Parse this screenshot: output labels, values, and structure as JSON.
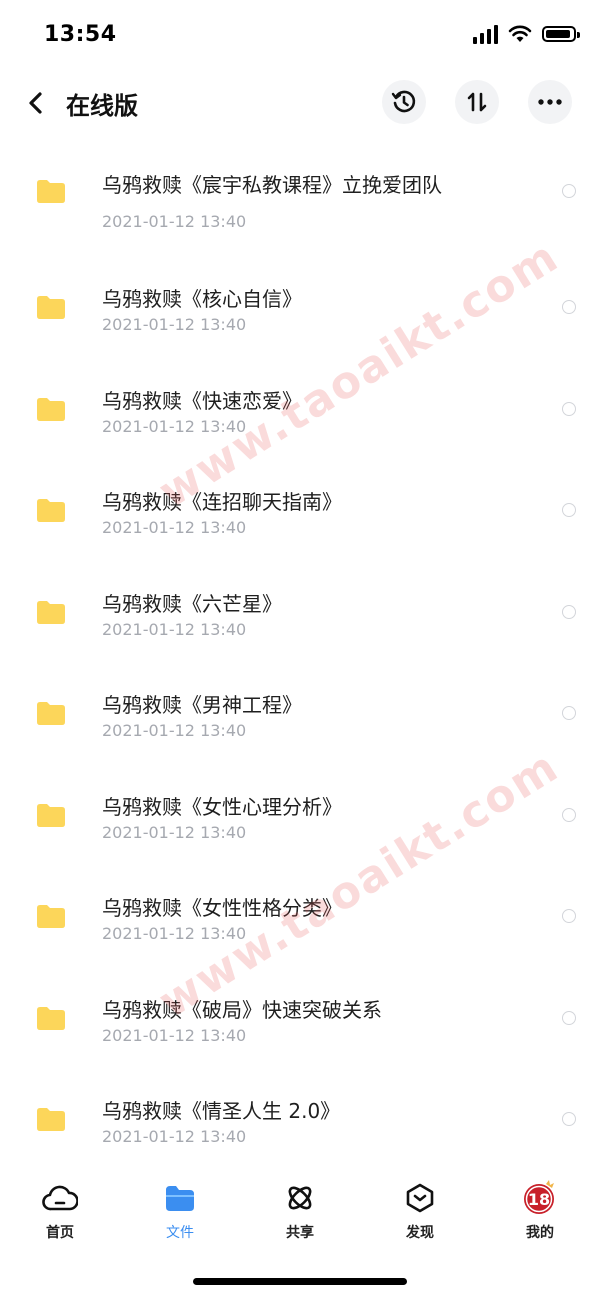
{
  "status_bar": {
    "time": "13:54"
  },
  "header": {
    "title": "在线版",
    "back_icon": "chevron-left-icon",
    "actions": [
      "history-icon",
      "sort-icon",
      "more-icon"
    ]
  },
  "files": [
    {
      "name": "乌鸦救赎《宸宇私教课程》立挽爱团队",
      "date": "2021-01-12 13:40"
    },
    {
      "name": "乌鸦救赎《核心自信》",
      "date": "2021-01-12 13:40"
    },
    {
      "name": "乌鸦救赎《快速恋爱》",
      "date": "2021-01-12 13:40"
    },
    {
      "name": "乌鸦救赎《连招聊天指南》",
      "date": "2021-01-12 13:40"
    },
    {
      "name": "乌鸦救赎《六芒星》",
      "date": "2021-01-12 13:40"
    },
    {
      "name": "乌鸦救赎《男神工程》",
      "date": "2021-01-12 13:40"
    },
    {
      "name": "乌鸦救赎《女性心理分析》",
      "date": "2021-01-12 13:40"
    },
    {
      "name": "乌鸦救赎《女性性格分类》",
      "date": "2021-01-12 13:40"
    },
    {
      "name": "乌鸦救赎《破局》快速突破关系",
      "date": "2021-01-12 13:40"
    },
    {
      "name": "乌鸦救赎《情圣人生 2.0》",
      "date": "2021-01-12 13:40"
    }
  ],
  "watermark": {
    "text": "www.taoaikt.com"
  },
  "tab_bar": {
    "active": "文件",
    "active_color": "#3b8ef0",
    "tabs": [
      {
        "label": "首页",
        "icon": "cloud-home-icon"
      },
      {
        "label": "文件",
        "icon": "folder-icon"
      },
      {
        "label": "共享",
        "icon": "atom-share-icon"
      },
      {
        "label": "发现",
        "icon": "hexagon-discover-icon"
      },
      {
        "label": "我的",
        "icon": "avatar-icon",
        "avatar_text": "18"
      }
    ]
  },
  "colors": {
    "folder": "#fcd65a",
    "date_text": "#a6a9b0",
    "accent": "#3b8ef0"
  }
}
